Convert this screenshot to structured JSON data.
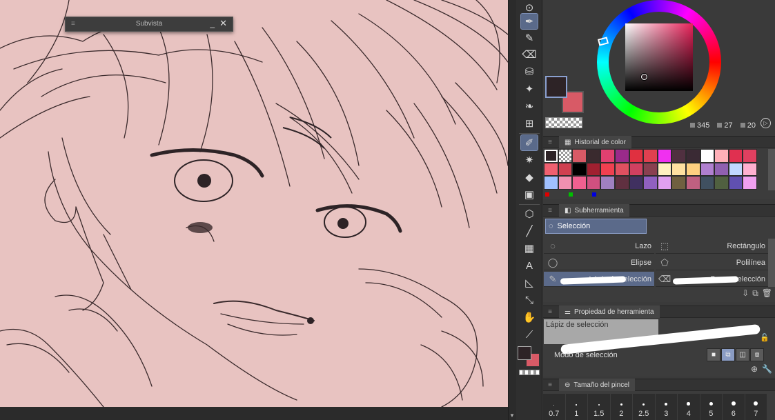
{
  "subview": {
    "title": "Subvista",
    "minimize": "_",
    "close": "✕"
  },
  "colors": {
    "main": "#2d2326",
    "sub": "#d85a66",
    "hue_display": "345",
    "saturation_display": "27",
    "value_display": "20"
  },
  "color_history": {
    "tab": "Historial de color",
    "swatches": [
      "#2d2326",
      "checker",
      "#d85a66",
      "#3a2a2e",
      "#e04070",
      "#9a2a8a",
      "#e03040",
      "#e04050",
      "#f030f0",
      "#503040",
      "#3a2a34",
      "#ffffff",
      "#ffb0b8",
      "#e03050",
      "#e04060",
      "#f06070",
      "#d04050",
      "#000000",
      "#a02030",
      "#f04050",
      "#e05060",
      "#d04060",
      "#8a4050",
      "#fff0c0",
      "#ffe0a0",
      "#ffd080",
      "#b080d0",
      "#9060b0",
      "#c0d8ff",
      "#ffb0d0",
      "#a0c0ff",
      "#f090b0",
      "#f06090",
      "#d05080",
      "#a080c0",
      "#603040",
      "#403060",
      "#9060c0",
      "#e0a0f0",
      "#706040",
      "#c06080",
      "#405060",
      "#506040",
      "#6050b0",
      "#f0a0f0"
    ]
  },
  "subtool": {
    "tab": "Subherramienta",
    "group": "Selección",
    "items": [
      {
        "label": "Lazo",
        "icon": "lasso-icon"
      },
      {
        "label": "Rectángulo",
        "icon": "rectangle-selection-icon"
      },
      {
        "label": "Elipse",
        "icon": "ellipse-selection-icon"
      },
      {
        "label": "Polilínea",
        "icon": "polyline-selection-icon"
      },
      {
        "label": "Lápiz de selección",
        "icon": "selection-pen-icon"
      },
      {
        "label": "Borrar selección",
        "icon": "erase-selection-icon"
      }
    ]
  },
  "tool_property": {
    "tab": "Propiedad de herramienta",
    "tool_name": "Lápiz de selección",
    "mode_label": "Modo de selección"
  },
  "brush_size": {
    "tab": "Tamaño del pincel",
    "sizes": [
      "0.7",
      "1",
      "1.5",
      "2",
      "2.5",
      "3",
      "4",
      "5",
      "6",
      "7"
    ]
  }
}
